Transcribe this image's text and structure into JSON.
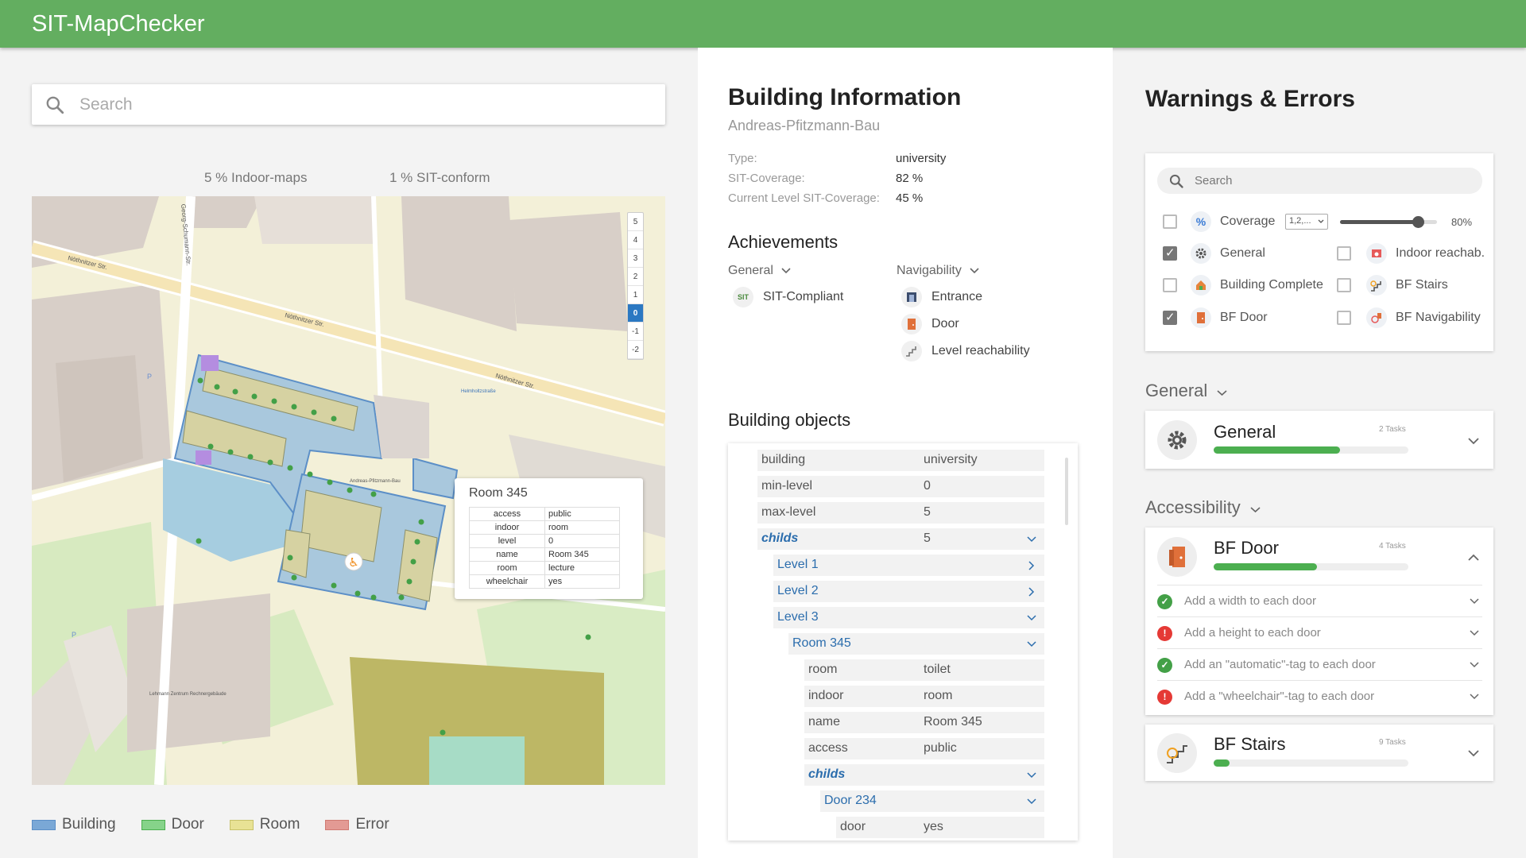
{
  "app": {
    "title": "SIT-MapChecker"
  },
  "map_panel": {
    "search_placeholder": "Search",
    "stat_indoor": "5 % Indoor-maps",
    "stat_sit": "1 % SIT-conform",
    "levels": [
      "5",
      "4",
      "3",
      "2",
      "1",
      "0",
      "-1",
      "-2"
    ],
    "active_level": "0",
    "streets": [
      "Nöthnitzer Str.",
      "Nöthnitzer Str.",
      "Nöthnitzer Str.",
      "Georg-Schumann-Str."
    ],
    "map_labels": [
      "Helmholtzstraße",
      "Andreas-Pfitzmann-Bau",
      "Lehmann Zentrum Rechnergebäude",
      "P",
      "P"
    ],
    "popup": {
      "title": "Room 345",
      "rows": [
        {
          "key": "access",
          "value": "public"
        },
        {
          "key": "indoor",
          "value": "room"
        },
        {
          "key": "level",
          "value": "0"
        },
        {
          "key": "name",
          "value": "Room 345"
        },
        {
          "key": "room",
          "value": "lecture"
        },
        {
          "key": "wheelchair",
          "value": "yes"
        }
      ]
    },
    "legend": [
      {
        "label": "Building",
        "color": "#7aa8d6"
      },
      {
        "label": "Door",
        "color": "#86d38a"
      },
      {
        "label": "Room",
        "color": "#e8e295"
      },
      {
        "label": "Error",
        "color": "#e39a94"
      }
    ]
  },
  "building_info": {
    "title": "Building Information",
    "subtitle": "Andreas-Pfitzmann-Bau",
    "fields": [
      {
        "key": "Type:",
        "value": "university"
      },
      {
        "key": "SIT-Coverage:",
        "value": "82 %"
      },
      {
        "key": "Current Level SIT-Coverage:",
        "value": "45 %"
      }
    ],
    "achievements": {
      "title": "Achievements",
      "general_label": "General",
      "navigability_label": "Navigability",
      "general_items": [
        {
          "label": "SIT-Compliant",
          "icon": "sit-badge-icon"
        }
      ],
      "navigability_items": [
        {
          "label": "Entrance",
          "icon": "entrance-icon"
        },
        {
          "label": "Door",
          "icon": "door-icon"
        },
        {
          "label": "Level reachability",
          "icon": "stairs-icon"
        }
      ]
    },
    "objects": {
      "title": "Building objects",
      "rows": [
        {
          "key": "building",
          "value": "university"
        },
        {
          "key": "min-level",
          "value": "0"
        },
        {
          "key": "max-level",
          "value": "5"
        },
        {
          "key": "childs",
          "value": "5"
        },
        {
          "key": "Level 1",
          "value": ""
        },
        {
          "key": "Level 2",
          "value": ""
        },
        {
          "key": "Level 3",
          "value": ""
        },
        {
          "key": "Room 345",
          "value": ""
        },
        {
          "key": "room",
          "value": "toilet"
        },
        {
          "key": "indoor",
          "value": "room"
        },
        {
          "key": "name",
          "value": "Room 345"
        },
        {
          "key": "access",
          "value": "public"
        },
        {
          "key": "childs",
          "value": ""
        },
        {
          "key": "Door 234",
          "value": ""
        },
        {
          "key": "door",
          "value": "yes"
        }
      ]
    }
  },
  "warnings": {
    "title": "Warnings & Errors",
    "search_placeholder": "Search",
    "coverage_label": "Coverage",
    "coverage_select": "1,2,...",
    "coverage_value": "80%",
    "coverage_fraction": 0.8,
    "filters": [
      {
        "label": "General",
        "checked": true,
        "icon": "gear-icon"
      },
      {
        "label": "Indoor reachab.",
        "checked": false,
        "icon": "indoor-icon"
      },
      {
        "label": "Building Complete",
        "checked": false,
        "icon": "building-icon"
      },
      {
        "label": "BF Stairs",
        "checked": false,
        "icon": "stairs-icon"
      },
      {
        "label": "BF Door",
        "checked": true,
        "icon": "door-icon"
      },
      {
        "label": "BF Navigability",
        "checked": false,
        "icon": "navigability-icon"
      }
    ],
    "sections": [
      {
        "label": "General",
        "cards": [
          {
            "title": "General",
            "tasks": "2 Tasks",
            "progress": 0.65
          }
        ]
      },
      {
        "label": "Accessibility",
        "cards": [
          {
            "title": "BF Door",
            "tasks": "4 Tasks",
            "progress": 0.53,
            "items": [
              {
                "text": "Add a width to each door",
                "status": "ok"
              },
              {
                "text": "Add a height to each door",
                "status": "error"
              },
              {
                "text": "Add an \"automatic\"-tag to each door",
                "status": "ok"
              },
              {
                "text": "Add a \"wheelchair\"-tag to each door",
                "status": "error"
              }
            ]
          },
          {
            "title": "BF Stairs",
            "tasks": "9 Tasks",
            "progress": 0.08
          }
        ]
      }
    ],
    "status_colors": {
      "ok": "#43a047",
      "error": "#e53935"
    }
  }
}
